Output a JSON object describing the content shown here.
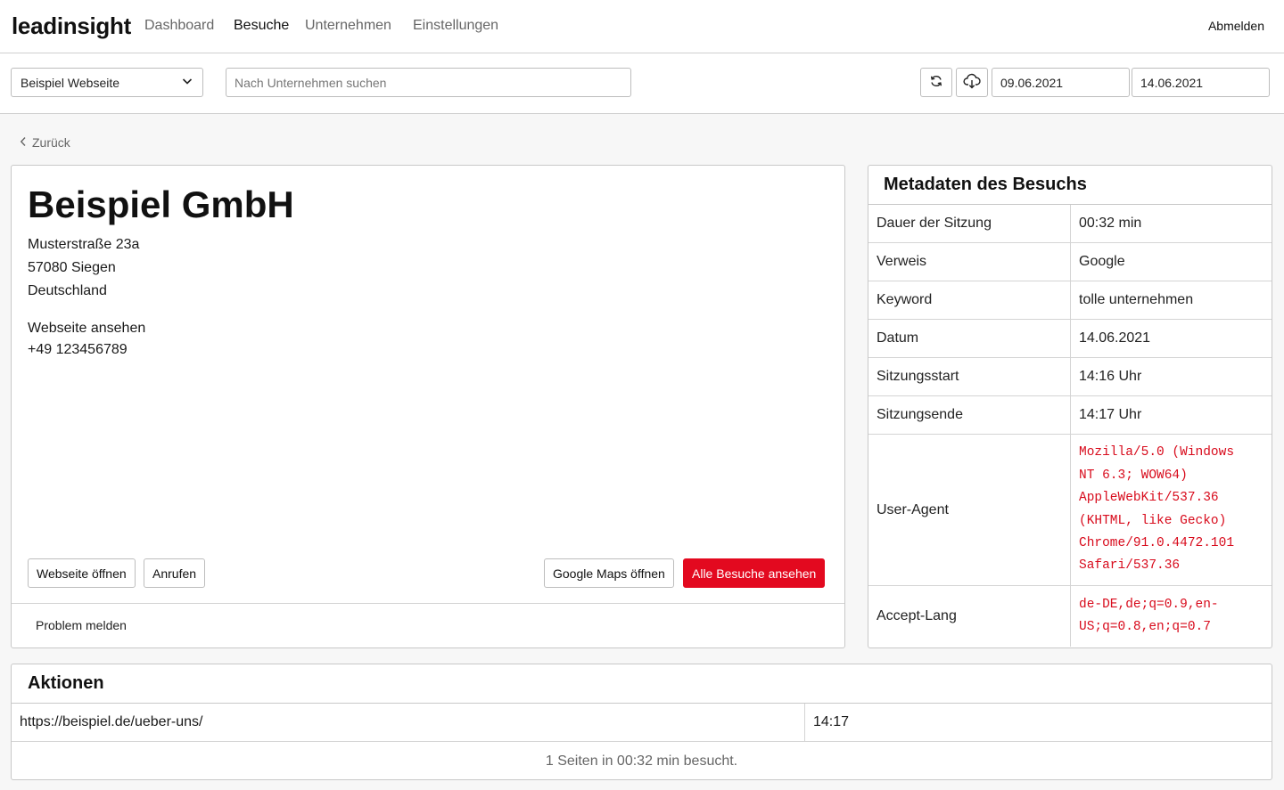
{
  "header": {
    "logo": "leadinsight",
    "nav": [
      {
        "label": "Dashboard",
        "active": false
      },
      {
        "label": "Besuche",
        "active": true
      },
      {
        "label": "Unternehmen",
        "active": false
      },
      {
        "label": "Einstellungen",
        "active": false
      }
    ],
    "logout_label": "Abmelden"
  },
  "toolbar": {
    "site_select": "Beispiel Webseite",
    "search_placeholder": "Nach Unternehmen suchen",
    "refresh_icon": "refresh-icon",
    "download_icon": "cloud-download-icon",
    "date_from": "09.06.2021",
    "date_to": "14.06.2021"
  },
  "back_label": "Zurück",
  "company": {
    "name": "Beispiel GmbH",
    "street": "Musterstraße 23a",
    "city": "57080 Siegen",
    "country": "Deutschland",
    "website_link": "Webseite ansehen",
    "phone": "+49 123456789",
    "buttons": {
      "open_website": "Webseite öffnen",
      "call": "Anrufen",
      "google_maps": "Google Maps öffnen",
      "all_visits": "Alle Besuche ansehen"
    },
    "report_problem": "Problem melden"
  },
  "metadata": {
    "title": "Metadaten des Besuchs",
    "rows": [
      {
        "key": "Dauer der Sitzung",
        "value": "00:32 min"
      },
      {
        "key": "Verweis",
        "value": "Google"
      },
      {
        "key": "Keyword",
        "value": "tolle unternehmen"
      },
      {
        "key": "Datum",
        "value": "14.06.2021"
      },
      {
        "key": "Sitzungsstart",
        "value": "14:16 Uhr"
      },
      {
        "key": "Sitzungsende",
        "value": "14:17 Uhr"
      },
      {
        "key": "User-Agent",
        "value": "Mozilla/5.0 (Windows\nNT 6.3; WOW64)\nAppleWebKit/537.36\n(KHTML, like Gecko)\nChrome/91.0.4472.101\nSafari/537.36"
      },
      {
        "key": "Accept-Lang",
        "value": "de-DE,de;q=0.9,en-\nUS;q=0.8,en;q=0.7"
      }
    ]
  },
  "actions": {
    "title": "Aktionen",
    "rows": [
      {
        "url": "https://beispiel.de/ueber-uns/",
        "time": "14:17"
      }
    ],
    "summary": "1 Seiten in 00:32 min besucht."
  },
  "colors": {
    "accent": "#e3091f",
    "code_text": "#d80b1c"
  }
}
